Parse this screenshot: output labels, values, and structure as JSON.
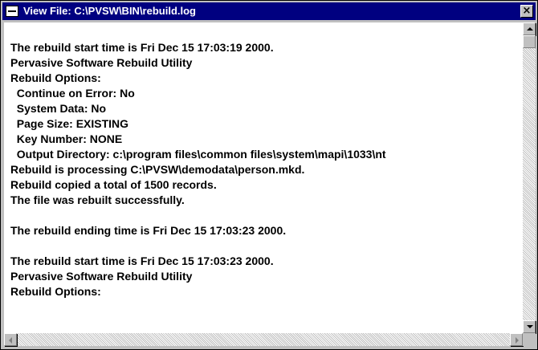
{
  "window": {
    "title": "View File: C:\\PVSW\\BIN\\rebuild.log",
    "close_label": "×"
  },
  "log": {
    "lines": [
      "",
      "The rebuild start time is Fri Dec 15 17:03:19 2000.",
      "Pervasive Software Rebuild Utility",
      "Rebuild Options:",
      "  Continue on Error: No",
      "  System Data: No",
      "  Page Size: EXISTING",
      "  Key Number: NONE",
      "  Output Directory: c:\\program files\\common files\\system\\mapi\\1033\\nt",
      "Rebuild is processing C:\\PVSW\\demodata\\person.mkd.",
      "Rebuild copied a total of 1500 records.",
      "The file was rebuilt successfully.",
      "",
      "The rebuild ending time is Fri Dec 15 17:03:23 2000.",
      "",
      "The rebuild start time is Fri Dec 15 17:03:23 2000.",
      "Pervasive Software Rebuild Utility",
      "Rebuild Options:"
    ]
  },
  "icons": {
    "system_menu": "system-menu-icon",
    "close": "close-icon",
    "scroll_up": "arrow-up-icon",
    "scroll_down": "arrow-down-icon",
    "scroll_left": "arrow-left-icon",
    "scroll_right": "arrow-right-icon"
  },
  "colors": {
    "titlebar": "#000080",
    "face": "#c0c0c0",
    "content_bg": "#ffffff"
  }
}
